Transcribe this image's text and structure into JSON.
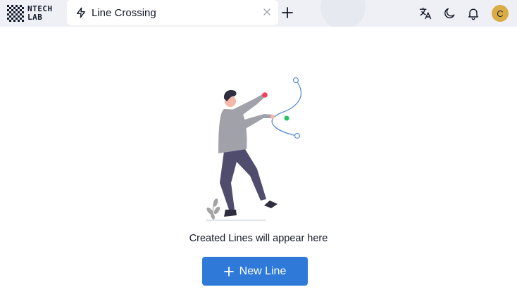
{
  "brand": {
    "logo_line1": "NTECH",
    "logo_line2": "LAB"
  },
  "tabs": [
    {
      "label": "Line Crossing",
      "icon": "lightning-icon",
      "active": true
    }
  ],
  "header_icons": [
    "translate-icon",
    "moon-icon",
    "bell-icon"
  ],
  "user": {
    "avatar_initial": "C",
    "avatar_color": "#d9ac45"
  },
  "empty_state": {
    "message": "Created Lines will appear here",
    "button_label": "New Line"
  },
  "colors": {
    "topbar_bg": "#eef0f5",
    "primary": "#2f7ad8",
    "line_stroke": "#5b8fd6",
    "red_dot": "#f43f5e",
    "green_dot": "#22c55e"
  }
}
